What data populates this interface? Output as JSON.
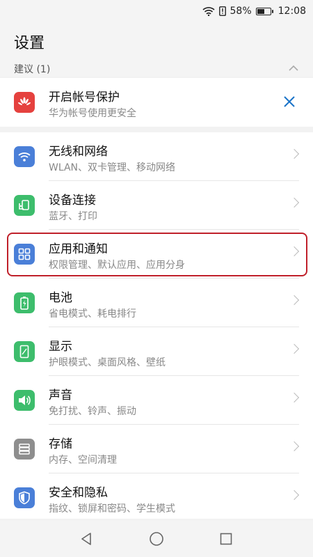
{
  "status": {
    "battery_percent": "58%",
    "time": "12:08",
    "battery_level": 0.58
  },
  "header": {
    "title": "设置"
  },
  "suggestion": {
    "header": "建议 (1)",
    "item": {
      "title": "开启帐号保护",
      "subtitle": "华为帐号使用更安全"
    }
  },
  "settings": [
    {
      "title": "无线和网络",
      "subtitle": "WLAN、双卡管理、移动网络",
      "icon": "wifi-icon",
      "color": "#4a7fd8"
    },
    {
      "title": "设备连接",
      "subtitle": "蓝牙、打印",
      "icon": "device-connect-icon",
      "color": "#3dbd6c"
    },
    {
      "title": "应用和通知",
      "subtitle": "权限管理、默认应用、应用分身",
      "icon": "apps-icon",
      "color": "#4a7fd8"
    },
    {
      "title": "电池",
      "subtitle": "省电模式、耗电排行",
      "icon": "battery-icon",
      "color": "#3dbd6c"
    },
    {
      "title": "显示",
      "subtitle": "护眼模式、桌面风格、壁纸",
      "icon": "display-icon",
      "color": "#3dbd6c"
    },
    {
      "title": "声音",
      "subtitle": "免打扰、铃声、振动",
      "icon": "sound-icon",
      "color": "#3dbd6c"
    },
    {
      "title": "存储",
      "subtitle": "内存、空间清理",
      "icon": "storage-icon",
      "color": "#8e8e8e"
    },
    {
      "title": "安全和隐私",
      "subtitle": "指纹、锁屏和密码、学生模式",
      "icon": "shield-icon",
      "color": "#4a7fd8"
    }
  ],
  "colors": {
    "highlight": "#c0202a",
    "huawei": "#e5413e",
    "accent": "#1a73c8"
  }
}
